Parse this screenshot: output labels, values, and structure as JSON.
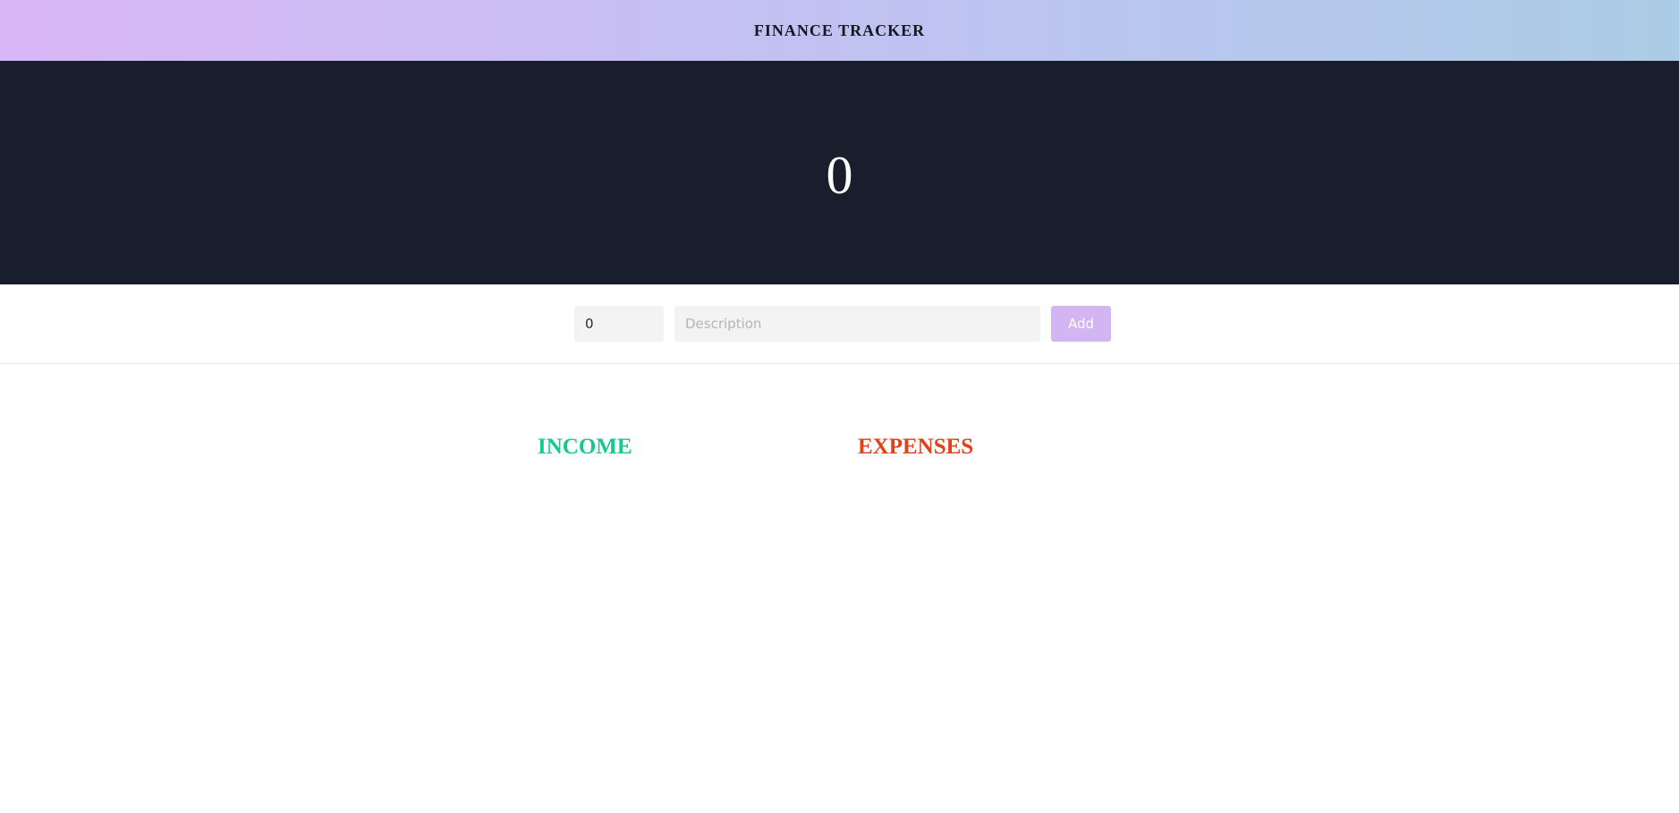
{
  "header": {
    "title": "FINANCE TRACKER"
  },
  "balance": {
    "value": "0"
  },
  "form": {
    "amount_value": "0",
    "description_value": "",
    "description_placeholder": "Description",
    "add_label": "Add"
  },
  "sections": {
    "income_label": "INCOME",
    "expenses_label": "EXPENSES"
  },
  "colors": {
    "header_gradient_start": "#d9b6f7",
    "header_gradient_end": "#abcce6",
    "balance_background": "#181e2b",
    "add_button": "#d4b5f4",
    "income": "#17c98b",
    "expenses": "#e0411a"
  }
}
